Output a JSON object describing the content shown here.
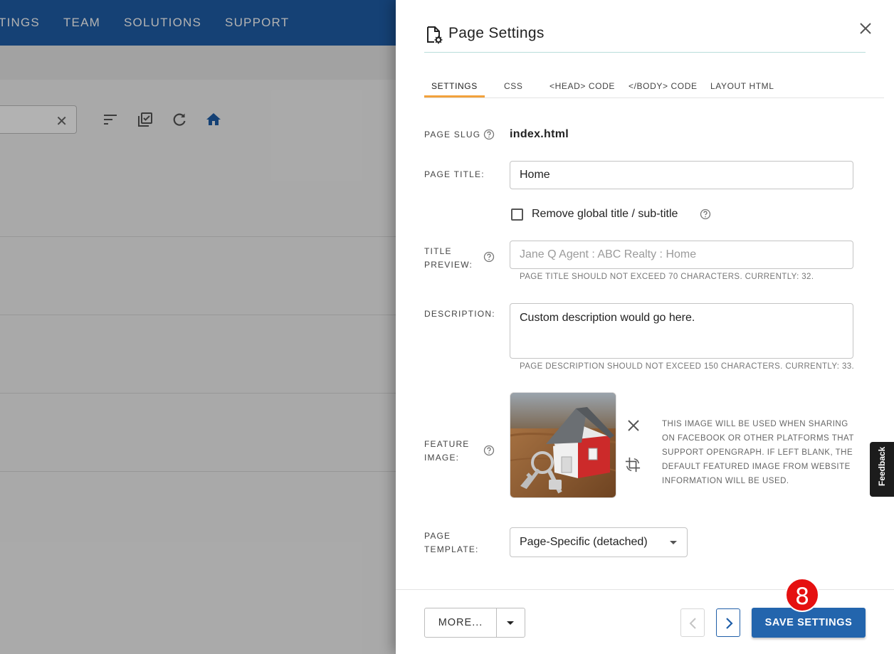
{
  "background": {
    "nav": [
      "TINGS",
      "TEAM",
      "SOLUTIONS",
      "SUPPORT"
    ],
    "toolbar_icons": [
      "sort-icon",
      "select-all-icon",
      "refresh-icon",
      "home-icon"
    ]
  },
  "drawer": {
    "title": "Page Settings",
    "tabs": [
      "SETTINGS",
      "CSS",
      "<HEAD> CODE",
      "</BODY> CODE",
      "LAYOUT HTML"
    ],
    "active_tab": "SETTINGS",
    "slug_label": "PAGE SLUG",
    "slug_value": "index.html",
    "page_title_label": "PAGE TITLE:",
    "page_title_value": "Home",
    "remove_global_label": "Remove global title / sub-title",
    "title_preview_label_1": "TITLE",
    "title_preview_label_2": "PREVIEW:",
    "title_preview_placeholder": "Jane Q Agent : ABC Realty : Home",
    "title_hint": "PAGE TITLE SHOULD NOT EXCEED 70 CHARACTERS. CURRENTLY: 32.",
    "description_label": "DESCRIPTION:",
    "description_value": "Custom description would go here.",
    "description_hint": "PAGE DESCRIPTION SHOULD NOT EXCEED 150 CHARACTERS. CURRENTLY: 33.",
    "feature_label_1": "FEATURE",
    "feature_label_2": "IMAGE:",
    "feature_note": "THIS IMAGE WILL BE USED WHEN SHARING ON FACEBOOK OR OTHER PLATFORMS THAT SUPPORT OPENGRAPH. IF LEFT BLANK, THE DEFAULT FEATURED IMAGE FROM WEBSITE INFORMATION WILL BE USED.",
    "template_label_1": "PAGE",
    "template_label_2": "TEMPLATE:",
    "template_value": "Page-Specific (detached)"
  },
  "footer": {
    "more_label": "MORE...",
    "save_label": "SAVE SETTINGS",
    "step_badge": "8"
  },
  "feedback": "Feedback",
  "colors": {
    "nav_blue": "#1f5ea8",
    "primary": "#2365ad",
    "tab_accent": "#f2a23c",
    "badge_red": "#e51010"
  }
}
